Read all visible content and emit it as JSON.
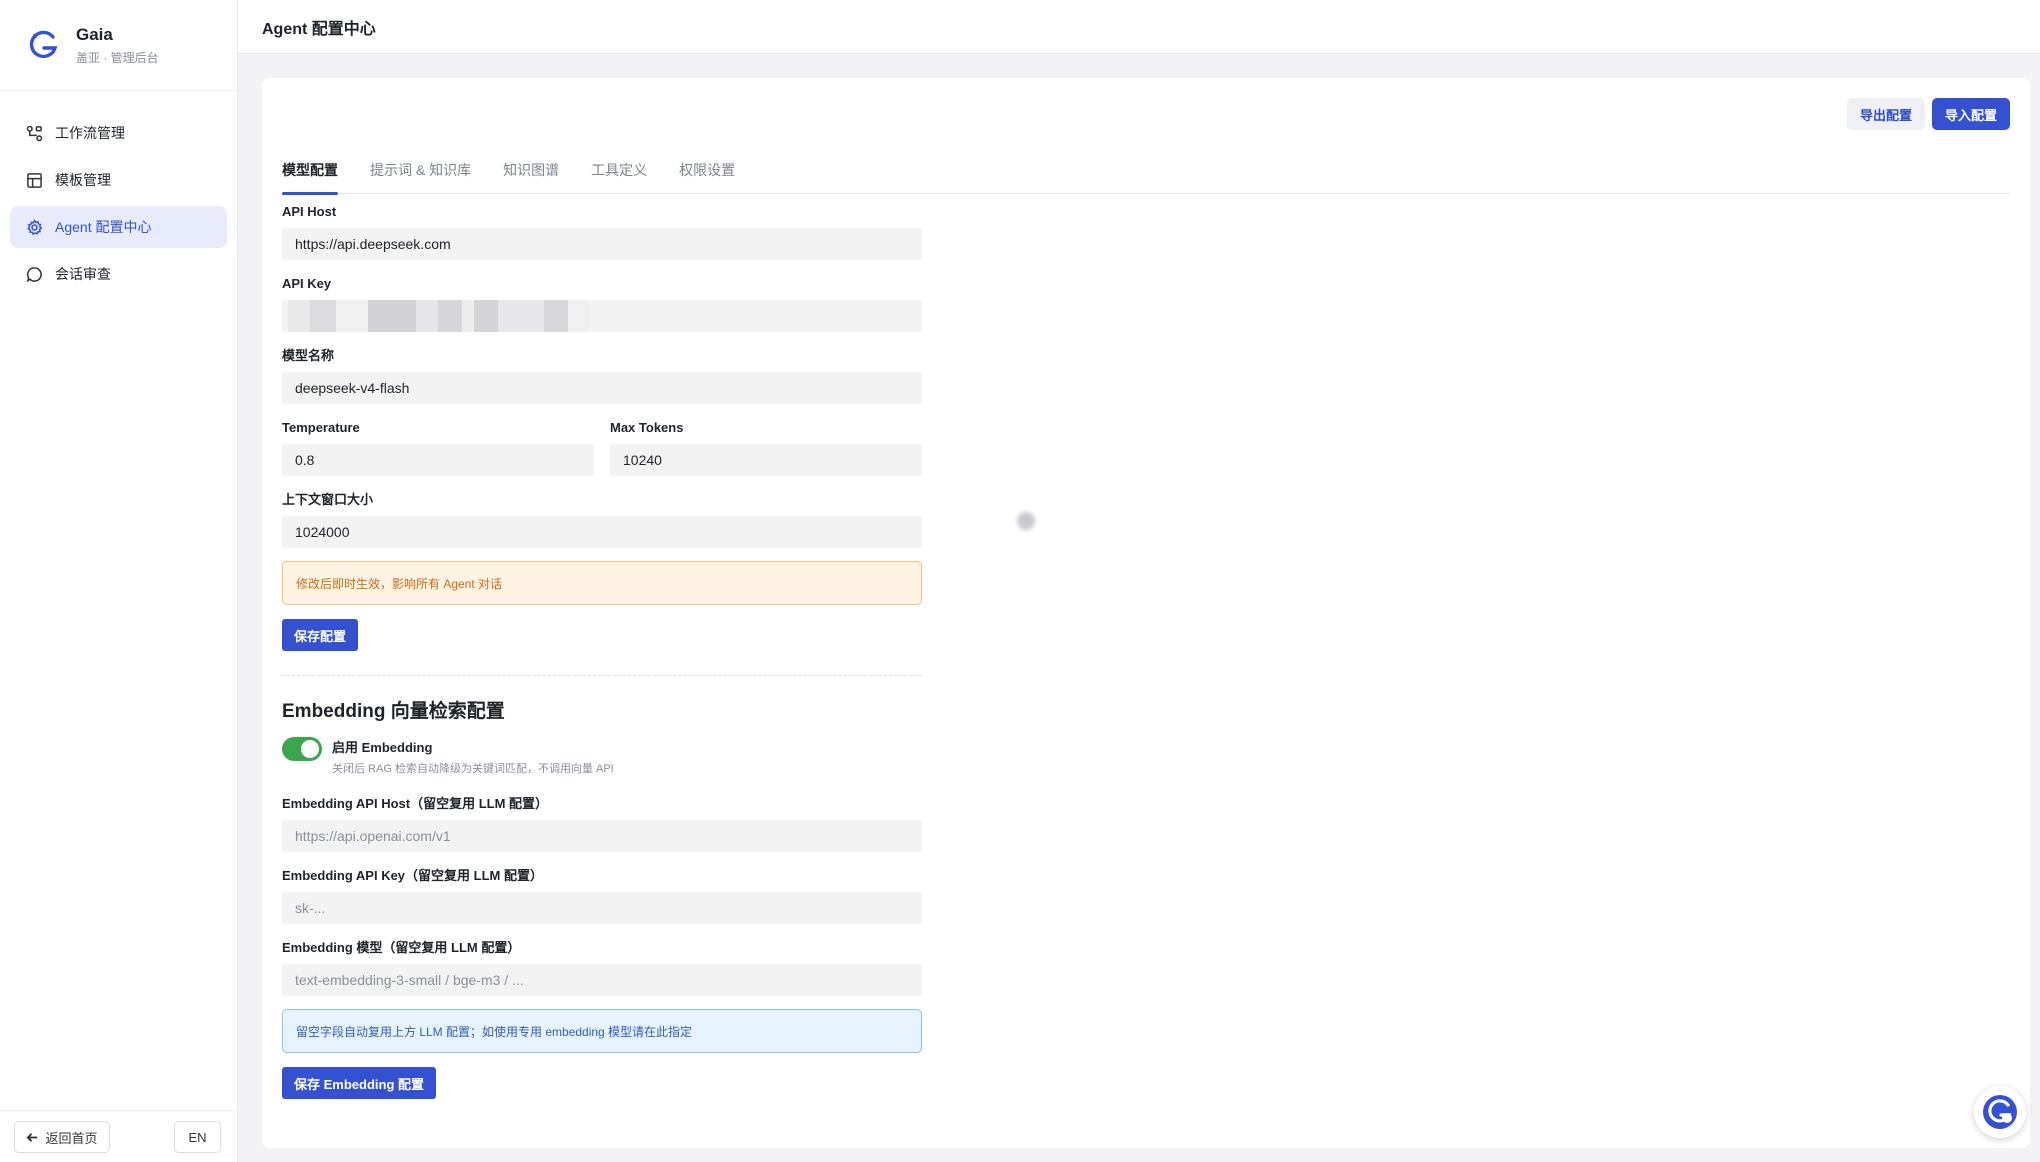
{
  "brand": {
    "name": "Gaia",
    "subtitle": "盖亚 · 管理后台"
  },
  "sidebar": {
    "items": [
      {
        "label": "工作流管理",
        "icon": "workflow-icon",
        "active": false
      },
      {
        "label": "模板管理",
        "icon": "template-icon",
        "active": false
      },
      {
        "label": "Agent 配置中心",
        "icon": "gear-icon",
        "active": true
      },
      {
        "label": "会话审查",
        "icon": "chat-bubble-icon",
        "active": false
      }
    ],
    "footer": {
      "back_label": "返回首页",
      "lang_label": "EN"
    }
  },
  "header": {
    "title": "Agent 配置中心"
  },
  "toolbar": {
    "export_label": "导出配置",
    "import_label": "导入配置"
  },
  "tabs": [
    {
      "label": "模型配置",
      "active": true
    },
    {
      "label": "提示词 & 知识库",
      "active": false
    },
    {
      "label": "知识图谱",
      "active": false
    },
    {
      "label": "工具定义",
      "active": false
    },
    {
      "label": "权限设置",
      "active": false
    }
  ],
  "model_config": {
    "api_host": {
      "label": "API Host",
      "value": "https://api.deepseek.com"
    },
    "api_key": {
      "label": "API Key",
      "value": ""
    },
    "model_name": {
      "label": "模型名称",
      "value": "deepseek-v4-flash"
    },
    "temperature": {
      "label": "Temperature",
      "value": "0.8"
    },
    "max_tokens": {
      "label": "Max Tokens",
      "value": "10240"
    },
    "context_window": {
      "label": "上下文窗口大小",
      "value": "1024000"
    },
    "warning": "修改后即时生效，影响所有 Agent 对话",
    "save_label": "保存配置"
  },
  "embedding": {
    "title": "Embedding 向量检索配置",
    "toggle_label": "启用 Embedding",
    "toggle_hint": "关闭后 RAG 检索自动降级为关键词匹配，不调用向量 API",
    "enabled": true,
    "api_host": {
      "label": "Embedding API Host（留空复用 LLM 配置）",
      "placeholder": "https://api.openai.com/v1"
    },
    "api_key": {
      "label": "Embedding API Key（留空复用 LLM 配置）",
      "placeholder": "sk-..."
    },
    "model": {
      "label": "Embedding 模型（留空复用 LLM 配置）",
      "placeholder": "text-embedding-3-small / bge-m3 / ..."
    },
    "info": "留空字段自动复用上方 LLM 配置；如使用专用 embedding 模型请在此指定",
    "save_label": "保存 Embedding 配置"
  },
  "colors": {
    "accent": "#3451d1",
    "toggle_on": "#3aa74c",
    "warn_bg": "#fff4e4",
    "info_bg": "#e6f2fd"
  }
}
